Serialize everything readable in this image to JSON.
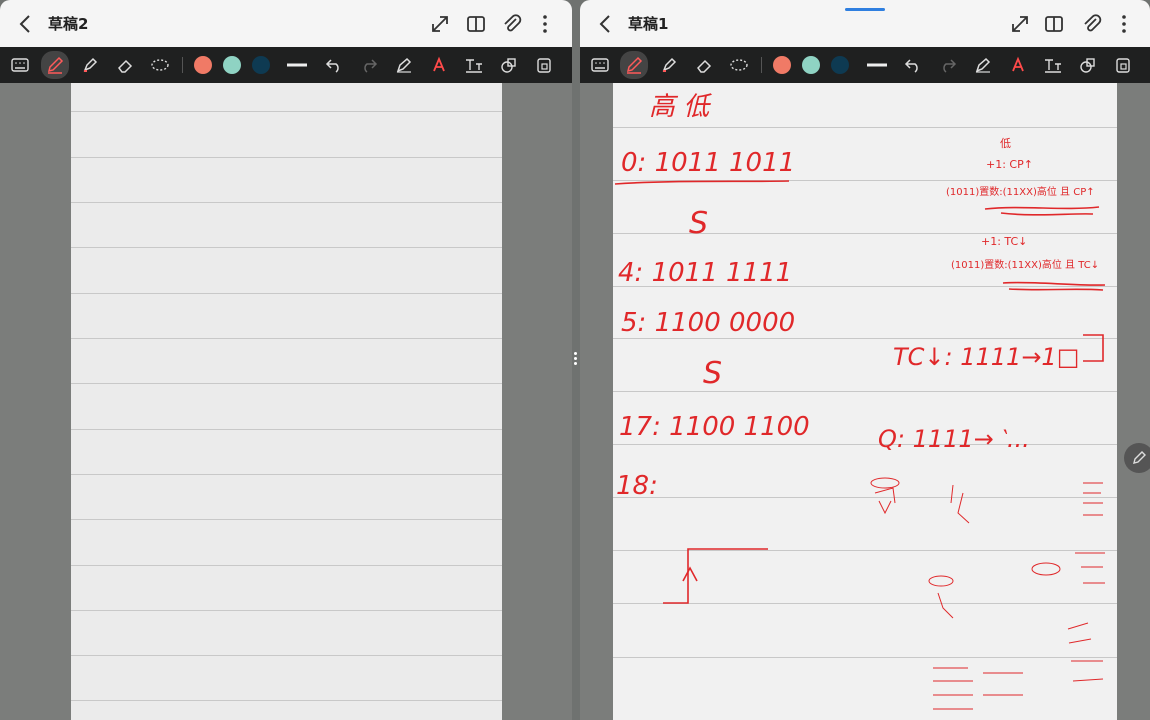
{
  "left_window": {
    "title": "草稿2",
    "ruled_line_count": 14
  },
  "right_window": {
    "title": "草稿1",
    "notes": {
      "header": "高 低",
      "row0": "0: 1011 1011",
      "sq1": "S",
      "row4": "4: 1011 1111",
      "row5": "5: 1100 0000",
      "sq2": "S",
      "row17": "17: 1100 1100",
      "row18": "18:",
      "side_top": "低",
      "side_1": "+1: CP↑",
      "side_2": "(1011)置数:(11XX)高位 且 CP↑",
      "side_3": "+1: TC↓",
      "side_4": "(1011)置数:(11XX)高位 且 TC↓",
      "side_5": "TC↓: 1111→1□",
      "side_6": "Q: 1111→ ‵..."
    }
  },
  "toolbar": {
    "colors": [
      "#f07a66",
      "#8fd3c3",
      "#0e3a52"
    ],
    "icons": [
      "keyboard-icon",
      "pen-icon",
      "highlighter-icon",
      "eraser-icon",
      "lasso-icon",
      "line-width-icon",
      "undo-icon",
      "redo-icon",
      "shape-pen-icon",
      "text-recognize-icon",
      "text-icon",
      "shapes-icon",
      "lock-icon"
    ]
  },
  "colors": {
    "ink": "#e0282a",
    "titlebar": "#f5f5f5",
    "toolbar": "#1f2020",
    "paper": "#ebebeb",
    "accent": "#2f7fe0"
  }
}
